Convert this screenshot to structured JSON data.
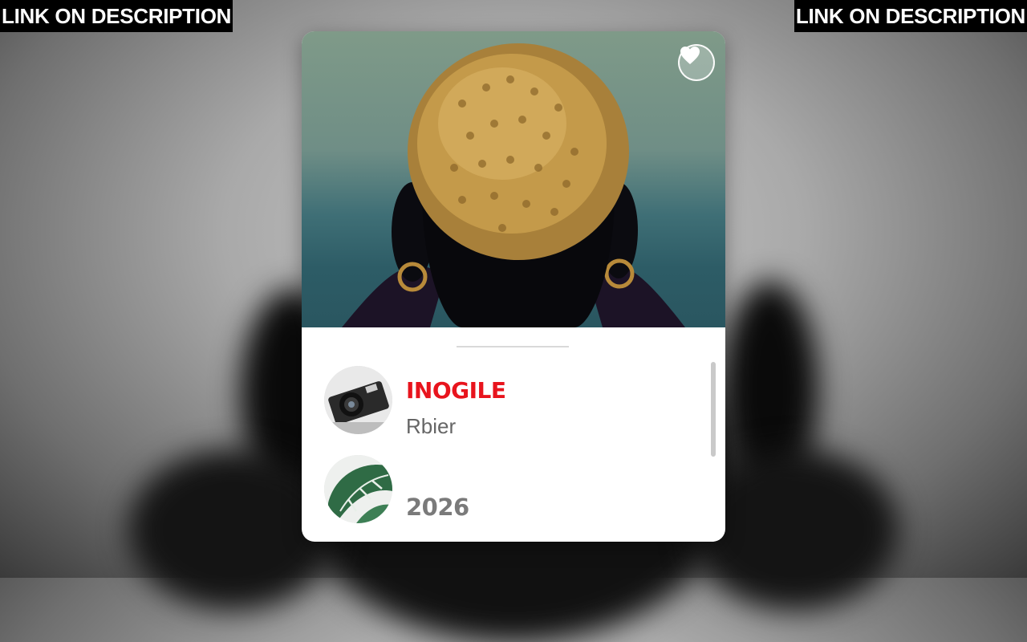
{
  "banners": {
    "left": "LINK ON DESCRIPTION",
    "right": "LINK ON DESCRIPTION"
  },
  "card": {
    "favorite_icon": "heart-icon",
    "items": [
      {
        "title": "INOGILE",
        "subtitle": "Rbier",
        "avatar_icon": "camera-photo"
      },
      {
        "year": "2026",
        "avatar_icon": "monstera-leaf-photo"
      }
    ]
  },
  "colors": {
    "accent": "#e8141d",
    "muted_text": "#666666",
    "card_bg": "#ffffff"
  }
}
